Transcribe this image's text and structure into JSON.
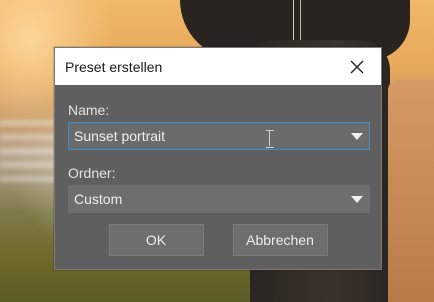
{
  "dialog": {
    "title": "Preset erstellen",
    "close_icon": "close-icon",
    "name_label": "Name:",
    "name_value": "Sunset portrait",
    "folder_label": "Ordner:",
    "folder_value": "Custom",
    "ok_label": "OK",
    "cancel_label": "Abbrechen"
  },
  "colors": {
    "dialog_bg": "#5f5f5f",
    "field_bg": "#6e6e6e",
    "focus_border": "#3d8fd1",
    "titlebar_bg": "#ffffff"
  }
}
